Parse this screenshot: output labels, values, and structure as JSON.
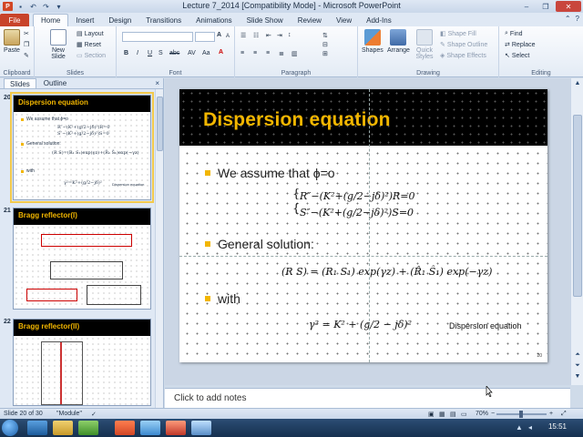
{
  "window": {
    "title": "Lecture 7_2014 [Compatibility Mode] - Microsoft PowerPoint",
    "minimize": "–",
    "maximize": "❐",
    "close": "✕"
  },
  "ribbon_tabs": {
    "file": "File",
    "items": [
      "Home",
      "Insert",
      "Design",
      "Transitions",
      "Animations",
      "Slide Show",
      "Review",
      "View",
      "Add-Ins"
    ]
  },
  "ribbon": {
    "clipboard": {
      "label": "Clipboard",
      "paste": "Paste"
    },
    "slides": {
      "label": "Slides",
      "new_slide": "New Slide",
      "layout": "Layout",
      "reset": "Reset",
      "section": "Section"
    },
    "font": {
      "label": "Font",
      "bold": "B",
      "italic": "I",
      "underline": "U",
      "strike": "S",
      "shadow": "abc",
      "spacing": "AV",
      "case": "Aa",
      "grow": "A",
      "shrink": "A"
    },
    "paragraph": {
      "label": "Paragraph"
    },
    "drawing": {
      "label": "Drawing",
      "shapes": "Shapes",
      "arrange": "Arrange",
      "quick_styles": "Quick Styles",
      "shape_fill": "Shape Fill",
      "shape_outline": "Shape Outline",
      "shape_effects": "Shape Effects"
    },
    "editing": {
      "label": "Editing",
      "find": "Find",
      "replace": "Replace",
      "select": "Select"
    }
  },
  "left_pane": {
    "tabs": [
      "Slides",
      "Outline"
    ],
    "close": "×",
    "thumbnails": [
      {
        "number": "20",
        "title": "Dispersion equation",
        "bullets": [
          "We assume that ϕ=o",
          "General solution:",
          "with"
        ],
        "caption": "Dispersion equation"
      },
      {
        "number": "21",
        "title": "Bragg reflector(I)"
      },
      {
        "number": "22",
        "title": "Bragg reflector(II)"
      }
    ]
  },
  "slide": {
    "title": "Dispersion equation",
    "bullets": [
      "We assume that ϕ=o",
      "General solution:",
      "with"
    ],
    "caption": "Dispersion equation",
    "page_number": "20",
    "equations": {
      "r_line": "R″−(K²+(g/2−jδ)²)R=0",
      "s_line": "S″−(K²+(g/2−jδ)²)S=0",
      "solution": "(R S) = (R₁ S₁) exp(γz) + (R̂₁ Ŝ₁) exp(−γz)",
      "gamma": "γ² = K² + (g/2 − jδ)²"
    }
  },
  "notes": {
    "placeholder": "Click to add notes"
  },
  "status": {
    "slide_info": "Slide 20 of 30",
    "theme": "\"Module\"",
    "zoom": "70%",
    "zoom_minus": "−",
    "zoom_plus": "+"
  },
  "taskbar": {
    "time": "15:51"
  }
}
